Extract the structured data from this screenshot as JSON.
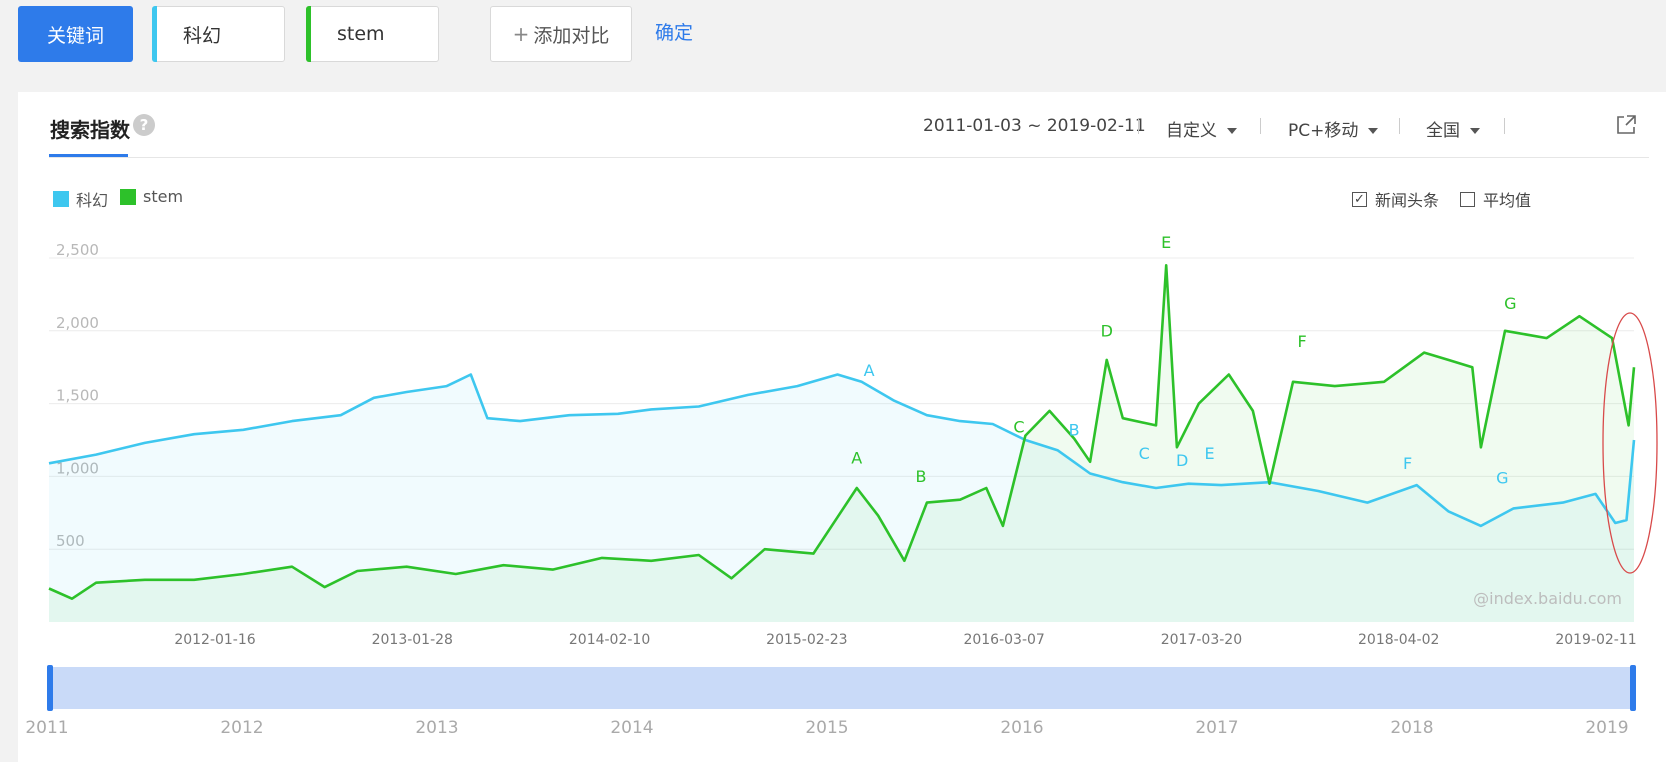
{
  "toolbar": {
    "keyword_label": "关键词",
    "terms": [
      {
        "label": "科幻",
        "color": "#3ec7ef"
      },
      {
        "label": "stem",
        "color": "#2dc12a"
      }
    ],
    "add_compare_label": "添加对比",
    "confirm_label": "确定"
  },
  "panel": {
    "title": "搜索指数",
    "help": "?",
    "date_range": "2011-01-03 ~ 2019-02-11",
    "range_mode": "自定义",
    "device": "PC+移动",
    "region": "全国",
    "news_label": "新闻头条",
    "news_checked": true,
    "avg_label": "平均值",
    "avg_checked": false,
    "watermark": "@index.baidu.com"
  },
  "chart_data": {
    "type": "line",
    "x_start": "2011-01-03",
    "x_end": "2019-02-11",
    "ylim": [
      0,
      2500
    ],
    "y_ticks": [
      "2,500",
      "2,000",
      "1,500",
      "1,000",
      "500"
    ],
    "x_tick_labels": [
      "2012-01-16",
      "2013-01-28",
      "2014-02-10",
      "2015-02-23",
      "2016-03-07",
      "2017-03-20",
      "2018-04-02",
      "2019-02-11"
    ],
    "navigator_years": [
      "2011",
      "2012",
      "2013",
      "2014",
      "2015",
      "2016",
      "2017",
      "2018",
      "2019"
    ],
    "grid": true,
    "legend": "top-left",
    "series": [
      {
        "name": "科幻",
        "color": "#3ec7ef",
        "points": [
          [
            "2011-01-03",
            1090
          ],
          [
            "2011-04-01",
            1150
          ],
          [
            "2011-07-01",
            1230
          ],
          [
            "2011-10-01",
            1290
          ],
          [
            "2012-01-01",
            1320
          ],
          [
            "2012-04-01",
            1380
          ],
          [
            "2012-07-01",
            1420
          ],
          [
            "2012-09-01",
            1540
          ],
          [
            "2012-11-01",
            1580
          ],
          [
            "2013-01-15",
            1620
          ],
          [
            "2013-03-01",
            1700
          ],
          [
            "2013-04-01",
            1400
          ],
          [
            "2013-06-01",
            1380
          ],
          [
            "2013-09-01",
            1420
          ],
          [
            "2013-12-01",
            1430
          ],
          [
            "2014-02-01",
            1460
          ],
          [
            "2014-05-01",
            1480
          ],
          [
            "2014-08-01",
            1560
          ],
          [
            "2014-11-01",
            1620
          ],
          [
            "2015-01-15",
            1700
          ],
          [
            "2015-03-01",
            1650
          ],
          [
            "2015-05-01",
            1520
          ],
          [
            "2015-07-01",
            1420
          ],
          [
            "2015-09-01",
            1380
          ],
          [
            "2015-11-01",
            1360
          ],
          [
            "2016-01-01",
            1250
          ],
          [
            "2016-03-01",
            1180
          ],
          [
            "2016-05-01",
            1020
          ],
          [
            "2016-07-01",
            960
          ],
          [
            "2016-09-01",
            920
          ],
          [
            "2016-11-01",
            950
          ],
          [
            "2017-01-01",
            940
          ],
          [
            "2017-04-01",
            960
          ],
          [
            "2017-07-01",
            900
          ],
          [
            "2017-10-01",
            820
          ],
          [
            "2018-01-01",
            940
          ],
          [
            "2018-03-01",
            760
          ],
          [
            "2018-05-01",
            660
          ],
          [
            "2018-07-01",
            780
          ],
          [
            "2018-10-01",
            820
          ],
          [
            "2018-12-01",
            880
          ],
          [
            "2019-01-07",
            680
          ],
          [
            "2019-01-28",
            700
          ],
          [
            "2019-02-11",
            1250
          ]
        ]
      },
      {
        "name": "stem",
        "color": "#2dc12a",
        "points": [
          [
            "2011-01-03",
            230
          ],
          [
            "2011-02-15",
            160
          ],
          [
            "2011-04-01",
            270
          ],
          [
            "2011-07-01",
            290
          ],
          [
            "2011-10-01",
            290
          ],
          [
            "2012-01-01",
            330
          ],
          [
            "2012-04-01",
            380
          ],
          [
            "2012-06-01",
            240
          ],
          [
            "2012-08-01",
            350
          ],
          [
            "2012-11-01",
            380
          ],
          [
            "2013-02-01",
            330
          ],
          [
            "2013-05-01",
            390
          ],
          [
            "2013-08-01",
            360
          ],
          [
            "2013-11-01",
            440
          ],
          [
            "2014-02-01",
            420
          ],
          [
            "2014-05-01",
            460
          ],
          [
            "2014-07-01",
            300
          ],
          [
            "2014-09-01",
            500
          ],
          [
            "2014-12-01",
            470
          ],
          [
            "2015-01-15",
            720
          ],
          [
            "2015-02-20",
            920
          ],
          [
            "2015-04-01",
            730
          ],
          [
            "2015-05-20",
            420
          ],
          [
            "2015-07-01",
            820
          ],
          [
            "2015-09-01",
            840
          ],
          [
            "2015-10-20",
            920
          ],
          [
            "2015-11-20",
            660
          ],
          [
            "2016-01-01",
            1280
          ],
          [
            "2016-02-15",
            1450
          ],
          [
            "2016-04-01",
            1260
          ],
          [
            "2016-05-01",
            1100
          ],
          [
            "2016-06-01",
            1800
          ],
          [
            "2016-07-01",
            1400
          ],
          [
            "2016-09-01",
            1350
          ],
          [
            "2016-09-20",
            2450
          ],
          [
            "2016-10-10",
            1200
          ],
          [
            "2016-11-20",
            1500
          ],
          [
            "2017-01-15",
            1700
          ],
          [
            "2017-03-01",
            1450
          ],
          [
            "2017-04-01",
            950
          ],
          [
            "2017-05-15",
            1650
          ],
          [
            "2017-08-01",
            1620
          ],
          [
            "2017-11-01",
            1650
          ],
          [
            "2018-01-15",
            1850
          ],
          [
            "2018-03-01",
            1800
          ],
          [
            "2018-04-15",
            1750
          ],
          [
            "2018-05-01",
            1200
          ],
          [
            "2018-06-15",
            2000
          ],
          [
            "2018-09-01",
            1950
          ],
          [
            "2018-11-01",
            2100
          ],
          [
            "2019-01-01",
            1950
          ],
          [
            "2019-02-01",
            1350
          ],
          [
            "2019-02-11",
            1750
          ]
        ]
      }
    ],
    "annotations": [
      {
        "label": "A",
        "series": "stem",
        "x": "2015-02-20",
        "y": 1090
      },
      {
        "label": "B",
        "series": "stem",
        "x": "2015-06-20",
        "y": 960
      },
      {
        "label": "C",
        "series": "stem",
        "x": "2015-12-20",
        "y": 1300
      },
      {
        "label": "D",
        "series": "stem",
        "x": "2016-06-01",
        "y": 1960
      },
      {
        "label": "E",
        "series": "stem",
        "x": "2016-09-20",
        "y": 2570
      },
      {
        "label": "F",
        "series": "stem",
        "x": "2017-06-01",
        "y": 1890
      },
      {
        "label": "G",
        "series": "stem",
        "x": "2018-06-25",
        "y": 2150
      },
      {
        "label": "A",
        "series": "科幻",
        "x": "2015-03-15",
        "y": 1690
      },
      {
        "label": "B",
        "series": "科幻",
        "x": "2016-04-01",
        "y": 1280
      },
      {
        "label": "C",
        "series": "科幻",
        "x": "2016-08-10",
        "y": 1120
      },
      {
        "label": "D",
        "series": "科幻",
        "x": "2016-10-20",
        "y": 1070
      },
      {
        "label": "E",
        "series": "科幻",
        "x": "2016-12-10",
        "y": 1120
      },
      {
        "label": "F",
        "series": "科幻",
        "x": "2017-12-15",
        "y": 1050
      },
      {
        "label": "G",
        "series": "科幻",
        "x": "2018-06-10",
        "y": 950
      }
    ]
  }
}
